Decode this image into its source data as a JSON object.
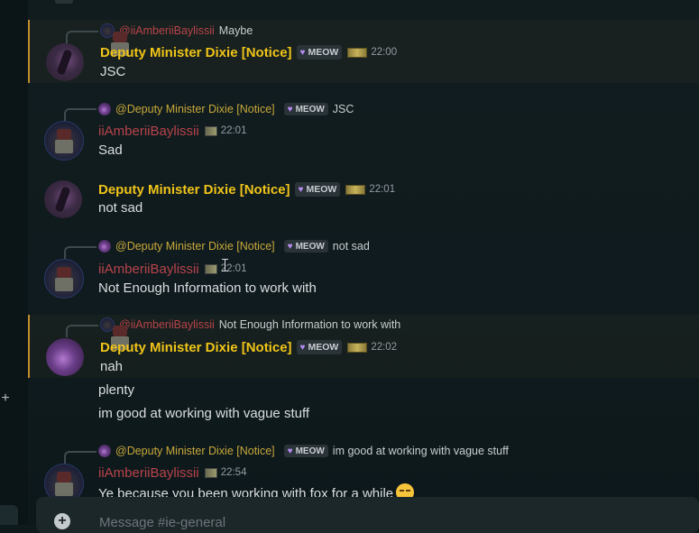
{
  "messages": [
    {
      "reply": {
        "name": "@iiAmberiiBaylissii",
        "text": "Maybe"
      },
      "author": "Deputy Minister Dixie [Notice]",
      "tag": "MEOW",
      "time": "22:00",
      "lines": [
        "JSC"
      ]
    },
    {
      "reply": {
        "name": "@Deputy Minister Dixie [Notice]",
        "tag": "MEOW",
        "text": "JSC"
      },
      "author": "iiAmberiiBaylissii",
      "time": "22:01",
      "lines": [
        "Sad"
      ]
    },
    {
      "author": "Deputy Minister Dixie [Notice]",
      "tag": "MEOW",
      "time": "22:01",
      "lines": [
        "not sad"
      ]
    },
    {
      "reply": {
        "name": "@Deputy Minister Dixie [Notice]",
        "tag": "MEOW",
        "text": "not sad"
      },
      "author": "iiAmberiiBaylissii",
      "time": "22:01",
      "lines": [
        "Not Enough Information to work with"
      ]
    },
    {
      "reply": {
        "name": "@iiAmberiiBaylissii",
        "text": "Not Enough Information to work with"
      },
      "author": "Deputy Minister Dixie [Notice]",
      "tag": "MEOW",
      "time": "22:02",
      "lines": [
        "nah",
        "plenty",
        "im good at working with vague stuff"
      ]
    },
    {
      "reply": {
        "name": "@Deputy Minister Dixie [Notice]",
        "tag": "MEOW",
        "text": "im good at working with vague stuff"
      },
      "author": "iiAmberiiBaylissii",
      "time": "22:54",
      "lines": [
        "Ye because you been working with fox for a while"
      ]
    }
  ],
  "composer": {
    "placeholder": "Message #ie-general"
  },
  "icons": {
    "composer_add": "plus-circle-icon",
    "rail_add": "plus-icon",
    "emoji": "loudly-crying-face-emoji",
    "cursor": "text-cursor-icon"
  },
  "colors": {
    "dixie_name": "#f0c419",
    "amber_name": "#b8434b",
    "highlight_bar": "#c28d2c",
    "tag_heart": "#b58cf0"
  }
}
